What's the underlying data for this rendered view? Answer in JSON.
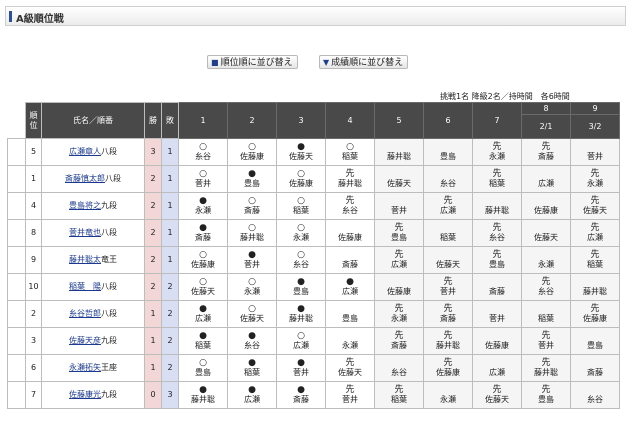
{
  "header": {
    "title": "A級順位戦"
  },
  "buttons": {
    "sort_rank": "順位順に並び替え",
    "sort_score": "成績順に並び替え"
  },
  "note": "挑戦1名 降級2名／持時間　各6時間",
  "columns": {
    "rank": "順位",
    "name": "氏名／順番",
    "wins": "勝",
    "losses": "敗",
    "rounds": [
      "1",
      "2",
      "3",
      "4",
      "5",
      "6",
      "7",
      "8",
      "9"
    ],
    "dates": {
      "8": "2/1",
      "9": "3/2"
    }
  },
  "rows": [
    {
      "rank": "5",
      "name": "広瀬章人",
      "title": "八段",
      "wins": "3",
      "losses": "1",
      "results": [
        [
          "○",
          "糸谷"
        ],
        [
          "○",
          "佐藤康"
        ],
        [
          "●",
          "佐藤天"
        ],
        [
          "○",
          "稲葉"
        ],
        [
          "",
          "藤井聡"
        ],
        [
          "",
          "豊島"
        ],
        [
          "先",
          "永瀬"
        ],
        [
          "先",
          "斎藤"
        ],
        [
          "",
          "菅井"
        ]
      ]
    },
    {
      "rank": "1",
      "name": "斎藤慎太郎",
      "title": "八段",
      "wins": "2",
      "losses": "1",
      "results": [
        [
          "○",
          "菅井"
        ],
        [
          "●",
          "豊島"
        ],
        [
          "○",
          "佐藤康"
        ],
        [
          "先",
          "藤井聡"
        ],
        [
          "",
          "佐藤天"
        ],
        [
          "",
          "糸谷"
        ],
        [
          "先",
          "稲葉"
        ],
        [
          "",
          "広瀬"
        ],
        [
          "先",
          "永瀬"
        ]
      ]
    },
    {
      "rank": "4",
      "name": "豊島将之",
      "title": "九段",
      "wins": "2",
      "losses": "1",
      "results": [
        [
          "●",
          "永瀬"
        ],
        [
          "○",
          "斎藤"
        ],
        [
          "○",
          "稲葉"
        ],
        [
          "先",
          "糸谷"
        ],
        [
          "",
          "菅井"
        ],
        [
          "先",
          "広瀬"
        ],
        [
          "",
          "藤井聡"
        ],
        [
          "",
          "佐藤康"
        ],
        [
          "先",
          "佐藤天"
        ]
      ]
    },
    {
      "rank": "8",
      "name": "菅井竜也",
      "title": "八段",
      "wins": "2",
      "losses": "1",
      "results": [
        [
          "●",
          "斎藤"
        ],
        [
          "○",
          "藤井聡"
        ],
        [
          "○",
          "永瀬"
        ],
        [
          "",
          "佐藤康"
        ],
        [
          "先",
          "豊島"
        ],
        [
          "",
          "稲葉"
        ],
        [
          "先",
          "糸谷"
        ],
        [
          "",
          "佐藤天"
        ],
        [
          "先",
          "広瀬"
        ]
      ]
    },
    {
      "rank": "9",
      "name": "藤井聡太",
      "title": "竜王",
      "wins": "2",
      "losses": "1",
      "results": [
        [
          "○",
          "佐藤康"
        ],
        [
          "●",
          "菅井"
        ],
        [
          "○",
          "糸谷"
        ],
        [
          "",
          "斎藤"
        ],
        [
          "先",
          "広瀬"
        ],
        [
          "",
          "佐藤天"
        ],
        [
          "先",
          "豊島"
        ],
        [
          "",
          "永瀬"
        ],
        [
          "先",
          "稲葉"
        ]
      ]
    },
    {
      "rank": "10",
      "name": "稲葉　陽",
      "title": "八段",
      "wins": "2",
      "losses": "2",
      "results": [
        [
          "○",
          "佐藤天"
        ],
        [
          "○",
          "永瀬"
        ],
        [
          "●",
          "豊島"
        ],
        [
          "●",
          "広瀬"
        ],
        [
          "",
          "佐藤康"
        ],
        [
          "先",
          "菅井"
        ],
        [
          "",
          "斎藤"
        ],
        [
          "先",
          "糸谷"
        ],
        [
          "",
          "藤井聡"
        ]
      ]
    },
    {
      "rank": "2",
      "name": "糸谷哲郎",
      "title": "八段",
      "wins": "1",
      "losses": "2",
      "results": [
        [
          "●",
          "広瀬"
        ],
        [
          "○",
          "佐藤天"
        ],
        [
          "●",
          "藤井聡"
        ],
        [
          "",
          "豊島"
        ],
        [
          "先",
          "永瀬"
        ],
        [
          "先",
          "斎藤"
        ],
        [
          "",
          "菅井"
        ],
        [
          "",
          "稲葉"
        ],
        [
          "先",
          "佐藤康"
        ]
      ]
    },
    {
      "rank": "3",
      "name": "佐藤天彦",
      "title": "九段",
      "wins": "1",
      "losses": "2",
      "results": [
        [
          "●",
          "稲葉"
        ],
        [
          "●",
          "糸谷"
        ],
        [
          "○",
          "広瀬"
        ],
        [
          "",
          "永瀬"
        ],
        [
          "先",
          "斎藤"
        ],
        [
          "先",
          "藤井聡"
        ],
        [
          "",
          "佐藤康"
        ],
        [
          "先",
          "菅井"
        ],
        [
          "",
          "豊島"
        ]
      ]
    },
    {
      "rank": "6",
      "name": "永瀬拓矢",
      "title": "王座",
      "wins": "1",
      "losses": "2",
      "results": [
        [
          "○",
          "豊島"
        ],
        [
          "●",
          "稲葉"
        ],
        [
          "●",
          "菅井"
        ],
        [
          "先",
          "佐藤天"
        ],
        [
          "",
          "糸谷"
        ],
        [
          "先",
          "佐藤康"
        ],
        [
          "",
          "広瀬"
        ],
        [
          "先",
          "藤井聡"
        ],
        [
          "",
          "斎藤"
        ]
      ]
    },
    {
      "rank": "7",
      "name": "佐藤康光",
      "title": "九段",
      "wins": "0",
      "losses": "3",
      "results": [
        [
          "●",
          "藤井聡"
        ],
        [
          "●",
          "広瀬"
        ],
        [
          "●",
          "斎藤"
        ],
        [
          "先",
          "菅井"
        ],
        [
          "先",
          "稲葉"
        ],
        [
          "",
          "永瀬"
        ],
        [
          "先",
          "佐藤天"
        ],
        [
          "先",
          "豊島"
        ],
        [
          "",
          "糸谷"
        ]
      ]
    }
  ]
}
